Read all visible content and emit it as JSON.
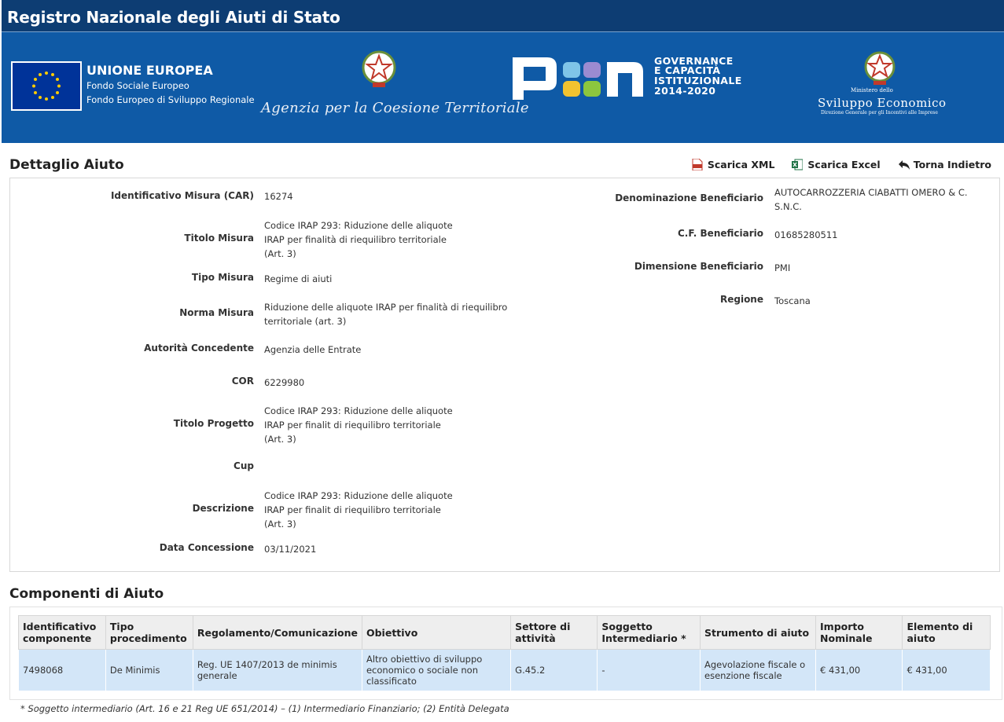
{
  "header": {
    "title": "Registro Nazionale degli Aiuti di Stato"
  },
  "banner": {
    "eu_title": "UNIONE EUROPEA",
    "eu_line1": "Fondo Sociale Europeo",
    "eu_line2": "Fondo Europeo di Sviluppo Regionale",
    "agency": "Agenzia per la Coesione Territoriale",
    "pon_lines": [
      "GOVERNANCE",
      "E CAPACITÀ",
      "ISTITUZIONALE",
      "2014-2020"
    ],
    "ministry_small": "Ministero dello",
    "ministry_big": "Sviluppo Economico",
    "ministry_sub": "Direzione Generale per gli Incentivi alle Imprese"
  },
  "detail": {
    "title": "Dettaglio Aiuto",
    "actions": {
      "xml": "Scarica XML",
      "excel": "Scarica Excel",
      "back": "Torna Indietro"
    },
    "left_fields": [
      {
        "label": "Identificativo Misura (CAR)",
        "value": "16274"
      },
      {
        "label": "Titolo Misura",
        "value": "Codice IRAP 293: Riduzione delle aliquote\nIRAP per finalità di riequilibro territoriale\n(Art. 3)"
      },
      {
        "label": "Tipo Misura",
        "value": "Regime di aiuti"
      },
      {
        "label": "Norma Misura",
        "value": "Riduzione delle aliquote IRAP per finalità di riequilibro\nterritoriale (art. 3)"
      },
      {
        "label": "Autorità Concedente",
        "value": "Agenzia delle Entrate"
      },
      {
        "label": "COR",
        "value": "6229980"
      },
      {
        "label": "Titolo Progetto",
        "value": "Codice IRAP 293: Riduzione delle aliquote\nIRAP per finalit di riequilibro territoriale\n(Art. 3)"
      },
      {
        "label": "Cup",
        "value": ""
      },
      {
        "label": "Descrizione",
        "value": "Codice IRAP 293: Riduzione delle aliquote\nIRAP per finalit di riequilibro territoriale\n(Art. 3)"
      },
      {
        "label": "Data Concessione",
        "value": "03/11/2021"
      }
    ],
    "right_fields": [
      {
        "label": "Denominazione Beneficiario",
        "value": "AUTOCARROZZERIA CIABATTI OMERO & C.\nS.N.C."
      },
      {
        "label": "C.F. Beneficiario",
        "value": "01685280511"
      },
      {
        "label": "Dimensione Beneficiario",
        "value": "PMI"
      },
      {
        "label": "Regione",
        "value": "Toscana"
      }
    ]
  },
  "components": {
    "title": "Componenti di Aiuto",
    "columns": [
      "Identificativo componente",
      "Tipo procedimento",
      "Regolamento/Comunicazione",
      "Obiettivo",
      "Settore di attività",
      "Soggetto Intermediario *",
      "Strumento di aiuto",
      "Importo Nominale",
      "Elemento di aiuto"
    ],
    "rows": [
      [
        "7498068",
        "De Minimis",
        "Reg. UE 1407/2013 de minimis generale",
        "Altro obiettivo di sviluppo economico o sociale non classificato",
        "G.45.2",
        "-",
        "Agevolazione fiscale o esenzione fiscale",
        "€ 431,00",
        "€ 431,00"
      ]
    ],
    "footnote": "* Soggetto intermediario (Art. 16 e 21 Reg UE 651/2014) – (1) Intermediario Finanziario; (2) Entità Delegata"
  },
  "colors": {
    "topbar": "#0d3d73",
    "banner": "#0f5aa6",
    "row_bg": "#d3e6f8",
    "header_bg": "#eeeeee"
  }
}
